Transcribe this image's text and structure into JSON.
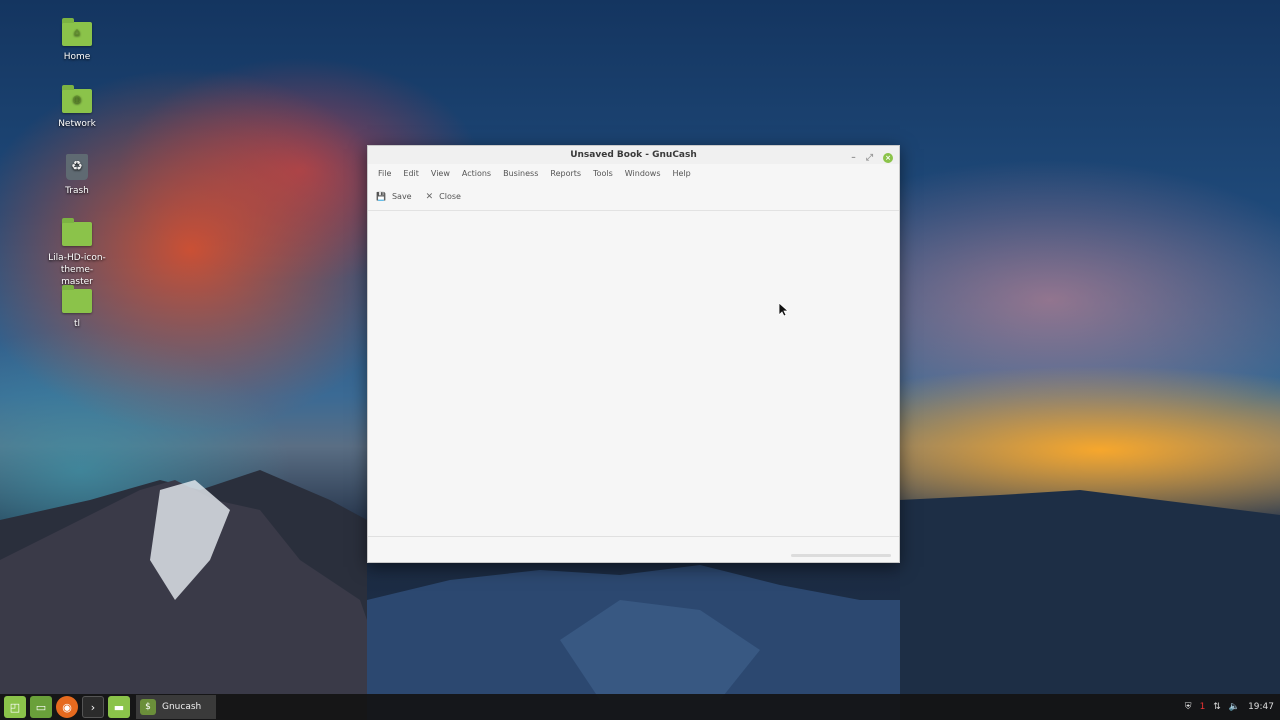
{
  "desktop": {
    "icons": [
      {
        "label": "Home",
        "symbol": "⌂"
      },
      {
        "label": "Network",
        "symbol": "◍"
      },
      {
        "label": "Trash",
        "symbol": "♻"
      },
      {
        "label": "Lila-HD-icon-theme-master",
        "symbol": ""
      },
      {
        "label": "tl",
        "symbol": ""
      }
    ]
  },
  "window": {
    "title": "Unsaved Book - GnuCash",
    "minimize_glyph": "–",
    "maximize_glyph": "⤢",
    "close_glyph": "×",
    "menus": [
      "File",
      "Edit",
      "View",
      "Actions",
      "Business",
      "Reports",
      "Tools",
      "Windows",
      "Help"
    ],
    "toolbar": {
      "save_label": "Save",
      "save_icon": "💾",
      "close_label": "Close",
      "close_icon": "✕"
    }
  },
  "taskbar": {
    "menu_icon": "mint-menu-icon",
    "launchers": [
      "show-desktop-icon",
      "firefox-icon",
      "terminal-icon",
      "files-icon"
    ],
    "task_label": "Gnucash",
    "clock": "19:47",
    "notification_count": "1"
  },
  "colors": {
    "accent_green": "#8bc34a",
    "taskbar_bg": "#141414"
  }
}
